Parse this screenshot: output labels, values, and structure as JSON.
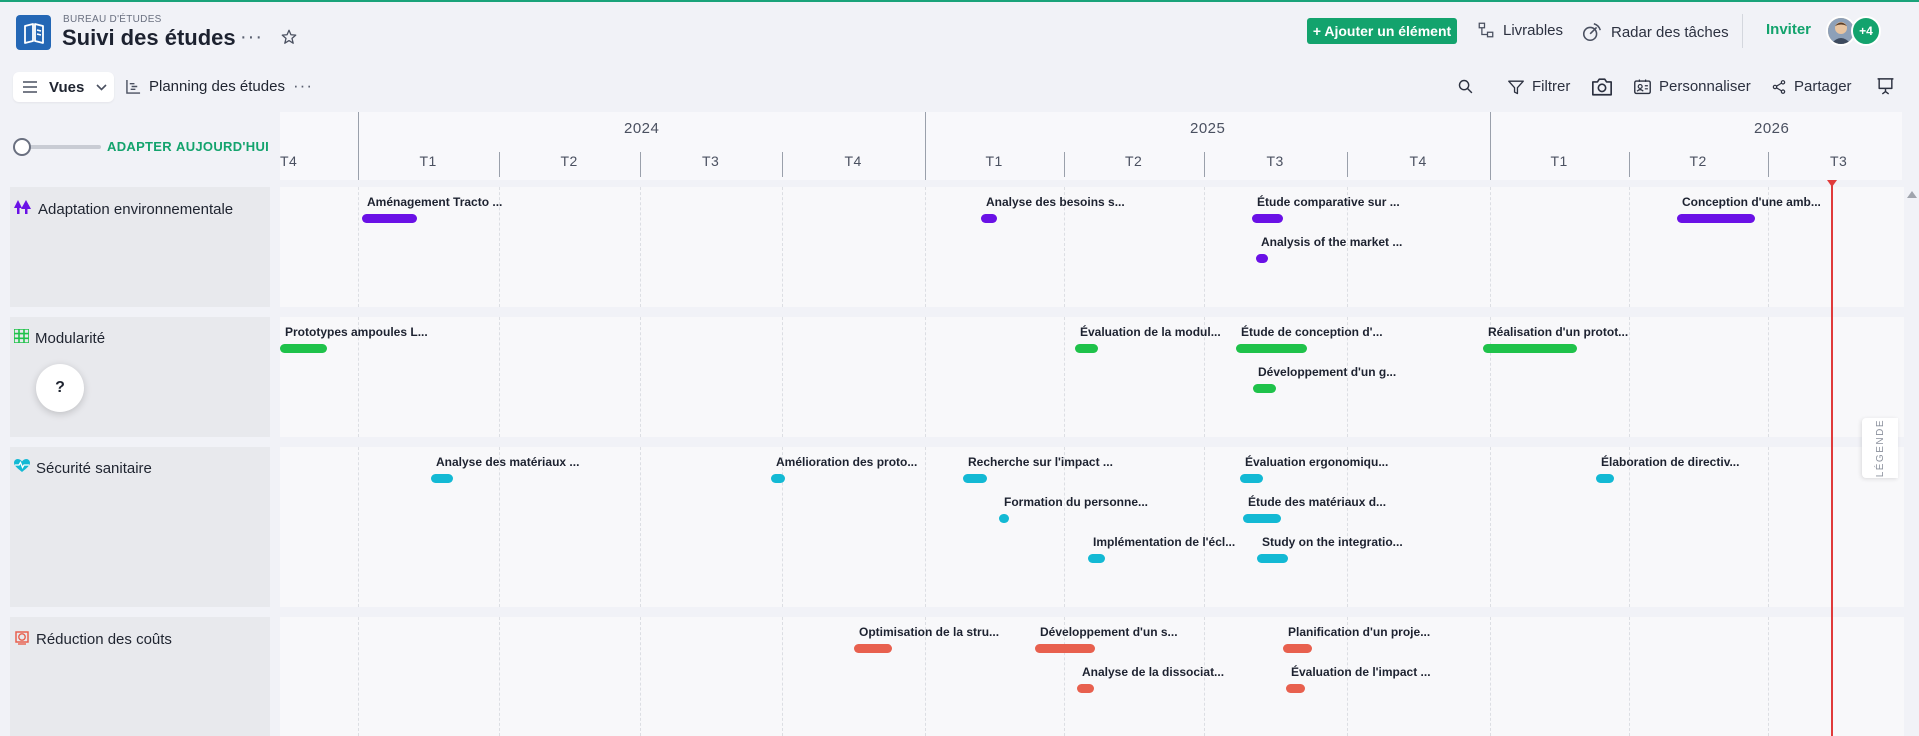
{
  "header": {
    "workspace": "BUREAU D'ÉTUDES",
    "title": "Suivi des études",
    "more": "···",
    "add_button": "+ Ajouter un élément",
    "livrables": "Livrables",
    "radar": "Radar des tâches",
    "invite": "Inviter",
    "extra_members": "+4"
  },
  "toolbar": {
    "views": "Vues",
    "view_name": "Planning des études",
    "more": "···",
    "filter": "Filtrer",
    "customize": "Personnaliser",
    "share": "Partager"
  },
  "zoom": {
    "fit": "ADAPTER",
    "today": "AUJOURD'HUI"
  },
  "timeline": {
    "years": [
      "2024",
      "2025",
      "2026"
    ],
    "quarters": [
      "T4",
      "T1",
      "T2",
      "T3",
      "T4",
      "T1",
      "T2",
      "T3",
      "T4",
      "T1",
      "T2",
      "T3"
    ]
  },
  "groups": [
    {
      "name": "Adaptation environnementale",
      "color": "#6a11e6",
      "icon": "trees-icon",
      "items": [
        {
          "label": "Aménagement Tracto ..."
        },
        {
          "label": "Analyse des besoins s..."
        },
        {
          "label": "Étude comparative sur ..."
        },
        {
          "label": "Analysis of the market ..."
        },
        {
          "label": "Conception d'une amb..."
        }
      ]
    },
    {
      "name": "Modularité",
      "color": "#1fc24a",
      "icon": "modules-icon",
      "items": [
        {
          "label": "Prototypes ampoules L..."
        },
        {
          "label": "Évaluation de la modul..."
        },
        {
          "label": "Étude de conception d'..."
        },
        {
          "label": "Réalisation d'un protot..."
        },
        {
          "label": "Développement d'un g..."
        }
      ]
    },
    {
      "name": "Sécurité sanitaire",
      "color": "#13b9d4",
      "icon": "heart-pulse-icon",
      "items": [
        {
          "label": "Analyse des matériaux ..."
        },
        {
          "label": "Amélioration des proto..."
        },
        {
          "label": "Recherche sur l'impact ..."
        },
        {
          "label": "Évaluation ergonomiqu..."
        },
        {
          "label": "Élaboration de directiv..."
        },
        {
          "label": "Formation du personne..."
        },
        {
          "label": "Étude des matériaux d..."
        },
        {
          "label": "Implémentation de l'écl..."
        },
        {
          "label": "Study on the integratio..."
        }
      ]
    },
    {
      "name": "Réduction des coûts",
      "color": "#e8604e",
      "icon": "coin-icon",
      "items": [
        {
          "label": "Optimisation de la stru..."
        },
        {
          "label": "Développement d'un s..."
        },
        {
          "label": "Planification d'un proje..."
        },
        {
          "label": "Analyse de la dissociat..."
        },
        {
          "label": "Évaluation de l'impact ..."
        }
      ]
    }
  ],
  "help": "?",
  "legend": "LÉGENDE"
}
